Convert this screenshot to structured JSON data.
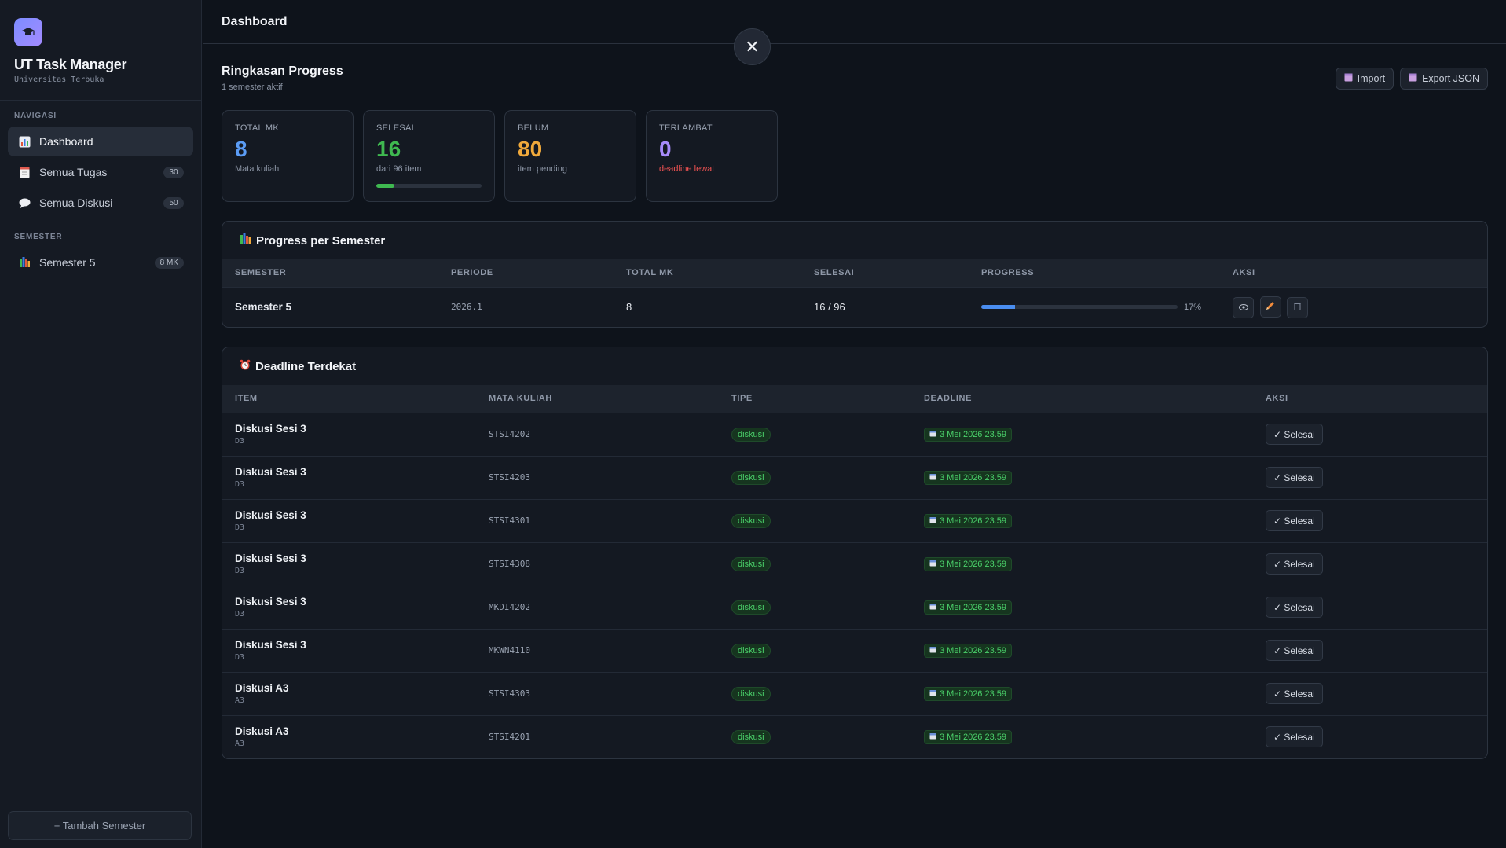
{
  "app": {
    "title": "UT Task Manager",
    "subtitle": "Universitas Terbuka"
  },
  "sidebar": {
    "nav_heading": "NAVIGASI",
    "nav_items": [
      {
        "label": "Dashboard",
        "icon": "bar-chart-icon",
        "count": ""
      },
      {
        "label": "Semua Tugas",
        "icon": "document-icon",
        "count": "30"
      },
      {
        "label": "Semua Diskusi",
        "icon": "speech-bubble-icon",
        "count": "50"
      }
    ],
    "semester_heading": "SEMESTER",
    "semesters": [
      {
        "label": "Semester 5",
        "icon": "books-icon",
        "count": "8 MK"
      }
    ],
    "add_semester_label": "+ Tambah Semester"
  },
  "topbar": {
    "title": "Dashboard",
    "close_symbol": "✕"
  },
  "summary": {
    "title": "Ringkasan Progress",
    "subtitle": "1 semester aktif",
    "import_label": "Import",
    "export_label": "Export JSON",
    "stats": [
      {
        "label": "TOTAL MK",
        "value": "8",
        "note": "Mata kuliah",
        "color": "#5b9cf5"
      },
      {
        "label": "SELESAI",
        "value": "16",
        "note": "dari 96 item",
        "color": "#3fb950",
        "progress": 0.17
      },
      {
        "label": "BELUM",
        "value": "80",
        "note": "item pending",
        "color": "#f0a93b"
      },
      {
        "label": "TERLAMBAT",
        "value": "0",
        "note": "deadline lewat",
        "color": "#a78bfa",
        "note_color": "#f05252"
      }
    ]
  },
  "progress_table": {
    "title": "Progress per Semester",
    "headers": [
      "SEMESTER",
      "PERIODE",
      "TOTAL MK",
      "SELESAI",
      "PROGRESS",
      "AKSI"
    ],
    "rows": [
      {
        "semester": "Semester 5",
        "periode": "2026.1",
        "total_mk": "8",
        "selesai": "16 / 96",
        "progress": 0.17,
        "progress_label": "17%"
      }
    ]
  },
  "deadline_table": {
    "title": "Deadline Terdekat",
    "headers": [
      "ITEM",
      "MATA KULIAH",
      "TIPE",
      "DEADLINE",
      "AKSI"
    ],
    "action_label": "✓ Selesai",
    "rows": [
      {
        "item": "Diskusi Sesi 3",
        "sub": "D3",
        "course": "STSI4202",
        "type": "diskusi",
        "deadline": "3 Mei 2026 23.59"
      },
      {
        "item": "Diskusi Sesi 3",
        "sub": "D3",
        "course": "STSI4203",
        "type": "diskusi",
        "deadline": "3 Mei 2026 23.59"
      },
      {
        "item": "Diskusi Sesi 3",
        "sub": "D3",
        "course": "STSI4301",
        "type": "diskusi",
        "deadline": "3 Mei 2026 23.59"
      },
      {
        "item": "Diskusi Sesi 3",
        "sub": "D3",
        "course": "STSI4308",
        "type": "diskusi",
        "deadline": "3 Mei 2026 23.59"
      },
      {
        "item": "Diskusi Sesi 3",
        "sub": "D3",
        "course": "MKDI4202",
        "type": "diskusi",
        "deadline": "3 Mei 2026 23.59"
      },
      {
        "item": "Diskusi Sesi 3",
        "sub": "D3",
        "course": "MKWN4110",
        "type": "diskusi",
        "deadline": "3 Mei 2026 23.59"
      },
      {
        "item": "Diskusi A3",
        "sub": "A3",
        "course": "STSI4303",
        "type": "diskusi",
        "deadline": "3 Mei 2026 23.59"
      },
      {
        "item": "Diskusi A3",
        "sub": "A3",
        "course": "STSI4201",
        "type": "diskusi",
        "deadline": "3 Mei 2026 23.59"
      }
    ]
  }
}
